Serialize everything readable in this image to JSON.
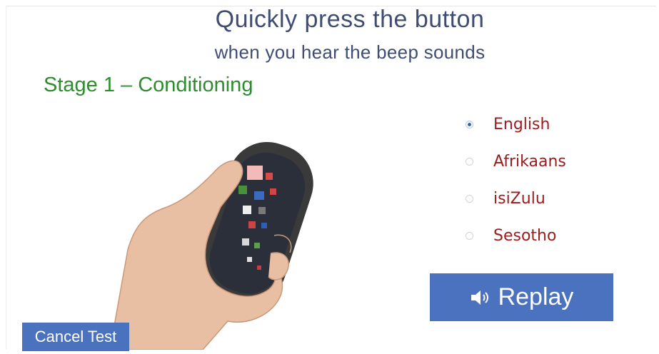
{
  "header": {
    "title": "Quickly press the button",
    "subtitle": "when you hear the beep sounds",
    "stage": "Stage 1 – Conditioning"
  },
  "image": {
    "icon": "hand-holding-response-button-photo"
  },
  "languages": {
    "selected": "English",
    "options": [
      {
        "label": "English",
        "selected": true
      },
      {
        "label": "Afrikaans",
        "selected": false
      },
      {
        "label": "isiZulu",
        "selected": false
      },
      {
        "label": "Sesotho",
        "selected": false
      }
    ]
  },
  "controls": {
    "replay_label": "Replay",
    "replay_icon": "speaker-icon",
    "cancel_label": "Cancel Test"
  },
  "colors": {
    "title": "#3f4d73",
    "stage": "#2e8b2e",
    "language_text": "#9b1c1c",
    "button_bg": "#4a72bf"
  }
}
